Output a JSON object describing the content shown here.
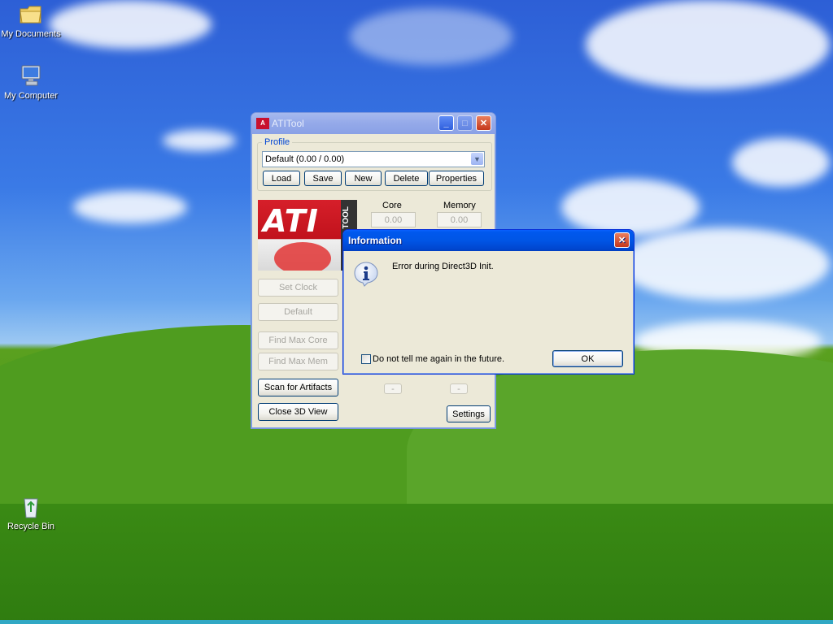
{
  "desktop": {
    "icons": [
      {
        "label": "My Documents",
        "icon": "folder-icon"
      },
      {
        "label": "My Computer",
        "icon": "computer-icon"
      },
      {
        "label": "Recycle Bin",
        "icon": "recycle-bin-icon"
      }
    ]
  },
  "atitool": {
    "title": "ATITool",
    "profile_label": "Profile",
    "profile_selected": "Default (0.00 / 0.00)",
    "buttons": {
      "load": "Load",
      "save": "Save",
      "new": "New",
      "delete": "Delete",
      "properties": "Properties",
      "set_clock": "Set Clock",
      "default": "Default",
      "find_max_core": "Find Max Core",
      "find_max_mem": "Find Max Mem",
      "scan_artifacts": "Scan for Artifacts",
      "close_3d_view": "Close 3D View",
      "settings": "Settings"
    },
    "core_label": "Core",
    "memory_label": "Memory",
    "core_value": "0.00",
    "memory_value": "0.00",
    "small_btn_left": "-",
    "small_btn_right": "-",
    "logo_text": "ATI",
    "logo_side_text": "TOOL"
  },
  "dialog": {
    "title": "Information",
    "message": "Error during Direct3D Init.",
    "checkbox_label": "Do not tell me again in the future.",
    "ok": "OK"
  },
  "colors": {
    "title_active": "#0055e5",
    "title_inactive": "#94a9e9",
    "window_bg": "#ece9d8",
    "close_red": "#c4371b"
  }
}
